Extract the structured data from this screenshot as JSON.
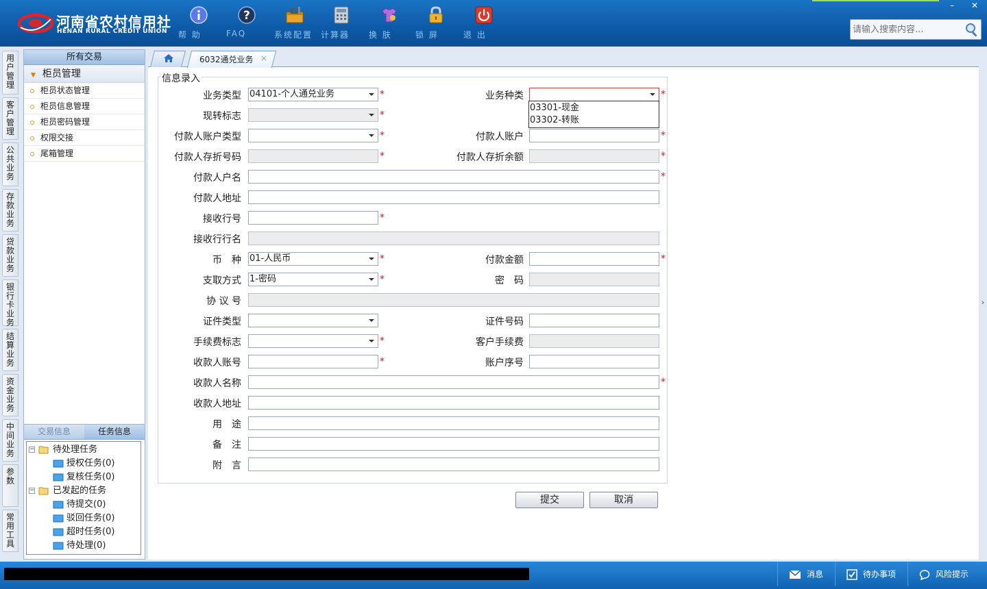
{
  "header": {
    "logo_cn": "河南省农村信用社",
    "logo_en": "HENAN RURAL CREDIT UNION",
    "tools": [
      {
        "label": "帮 助",
        "icon": "info-icon"
      },
      {
        "label": "FAQ",
        "icon": "question-icon"
      },
      {
        "label": "系统配置",
        "icon": "toolbox-icon"
      },
      {
        "label": "计算器",
        "icon": "calculator-icon"
      },
      {
        "label": "换 肤",
        "icon": "shirt-icon"
      },
      {
        "label": "锁 屏",
        "icon": "lock-icon"
      },
      {
        "label": "退 出",
        "icon": "power-icon"
      }
    ],
    "minimize": "–",
    "close": "✕",
    "search_placeholder": "请输入搜索内容..."
  },
  "vtabs": [
    "用户管理",
    "客户管理",
    "公共业务",
    "存款业务",
    "贷款业务",
    "银行卡业务",
    "结算业务",
    "资金业务",
    "中间业务",
    "参数",
    "常用工具"
  ],
  "left_panel": {
    "header": "所有交易",
    "group": "柜员管理",
    "items": [
      "柜员状态管理",
      "柜员信息管理",
      "柜员密码管理",
      "权限交接",
      "尾箱管理"
    ]
  },
  "task_panel": {
    "tab_inactive": "交易信息",
    "tab_active": "任务信息",
    "tree": {
      "pending": "待处理任务",
      "auth": "授权任务(0)",
      "review": "复核任务(0)",
      "initiated": "已发起的任务",
      "to_submit": "待提交(0)",
      "rejected": "驳回任务(0)",
      "timeout": "超时任务(0)",
      "to_process": "待处理(0)"
    }
  },
  "tabs": {
    "active": "6032通兑业务",
    "close": "×"
  },
  "form": {
    "legend": "信息录入",
    "labels": {
      "biz_type": "业务类型",
      "biz_kind": "业务种类",
      "cash_flag": "现转标志",
      "payer_acct_type": "付款人账户类型",
      "payer_acct": "付款人账户",
      "payer_book_no": "付款人存折号码",
      "payer_book_bal": "付款人存折余额",
      "payer_name": "付款人户名",
      "payer_addr": "付款人地址",
      "recv_bank_no": "接收行号",
      "recv_bank_name": "接收行行名",
      "currency": "币　种",
      "amount": "付款金额",
      "withdraw": "支取方式",
      "password": "密　码",
      "agreement": "协 议 号",
      "id_type": "证件类型",
      "id_no": "证件号码",
      "fee_flag": "手续费标志",
      "cust_fee": "客户手续费",
      "payee_acct": "收款人账号",
      "acct_seq": "账户序号",
      "payee_name": "收款人名称",
      "payee_addr": "收款人地址",
      "purpose": "用　途",
      "remark": "备　注",
      "postscript": "附　言"
    },
    "values": {
      "biz_type": "04101-个人通兑业务",
      "currency": "01-人民币",
      "withdraw": "1-密码"
    },
    "dropdown_options": [
      "03301-现金",
      "03302-转账"
    ],
    "required_mark": "*",
    "submit": "提交",
    "cancel": "取消"
  },
  "statusbar": {
    "messages": "消息",
    "todo": "待办事项",
    "risk": "风险提示"
  }
}
